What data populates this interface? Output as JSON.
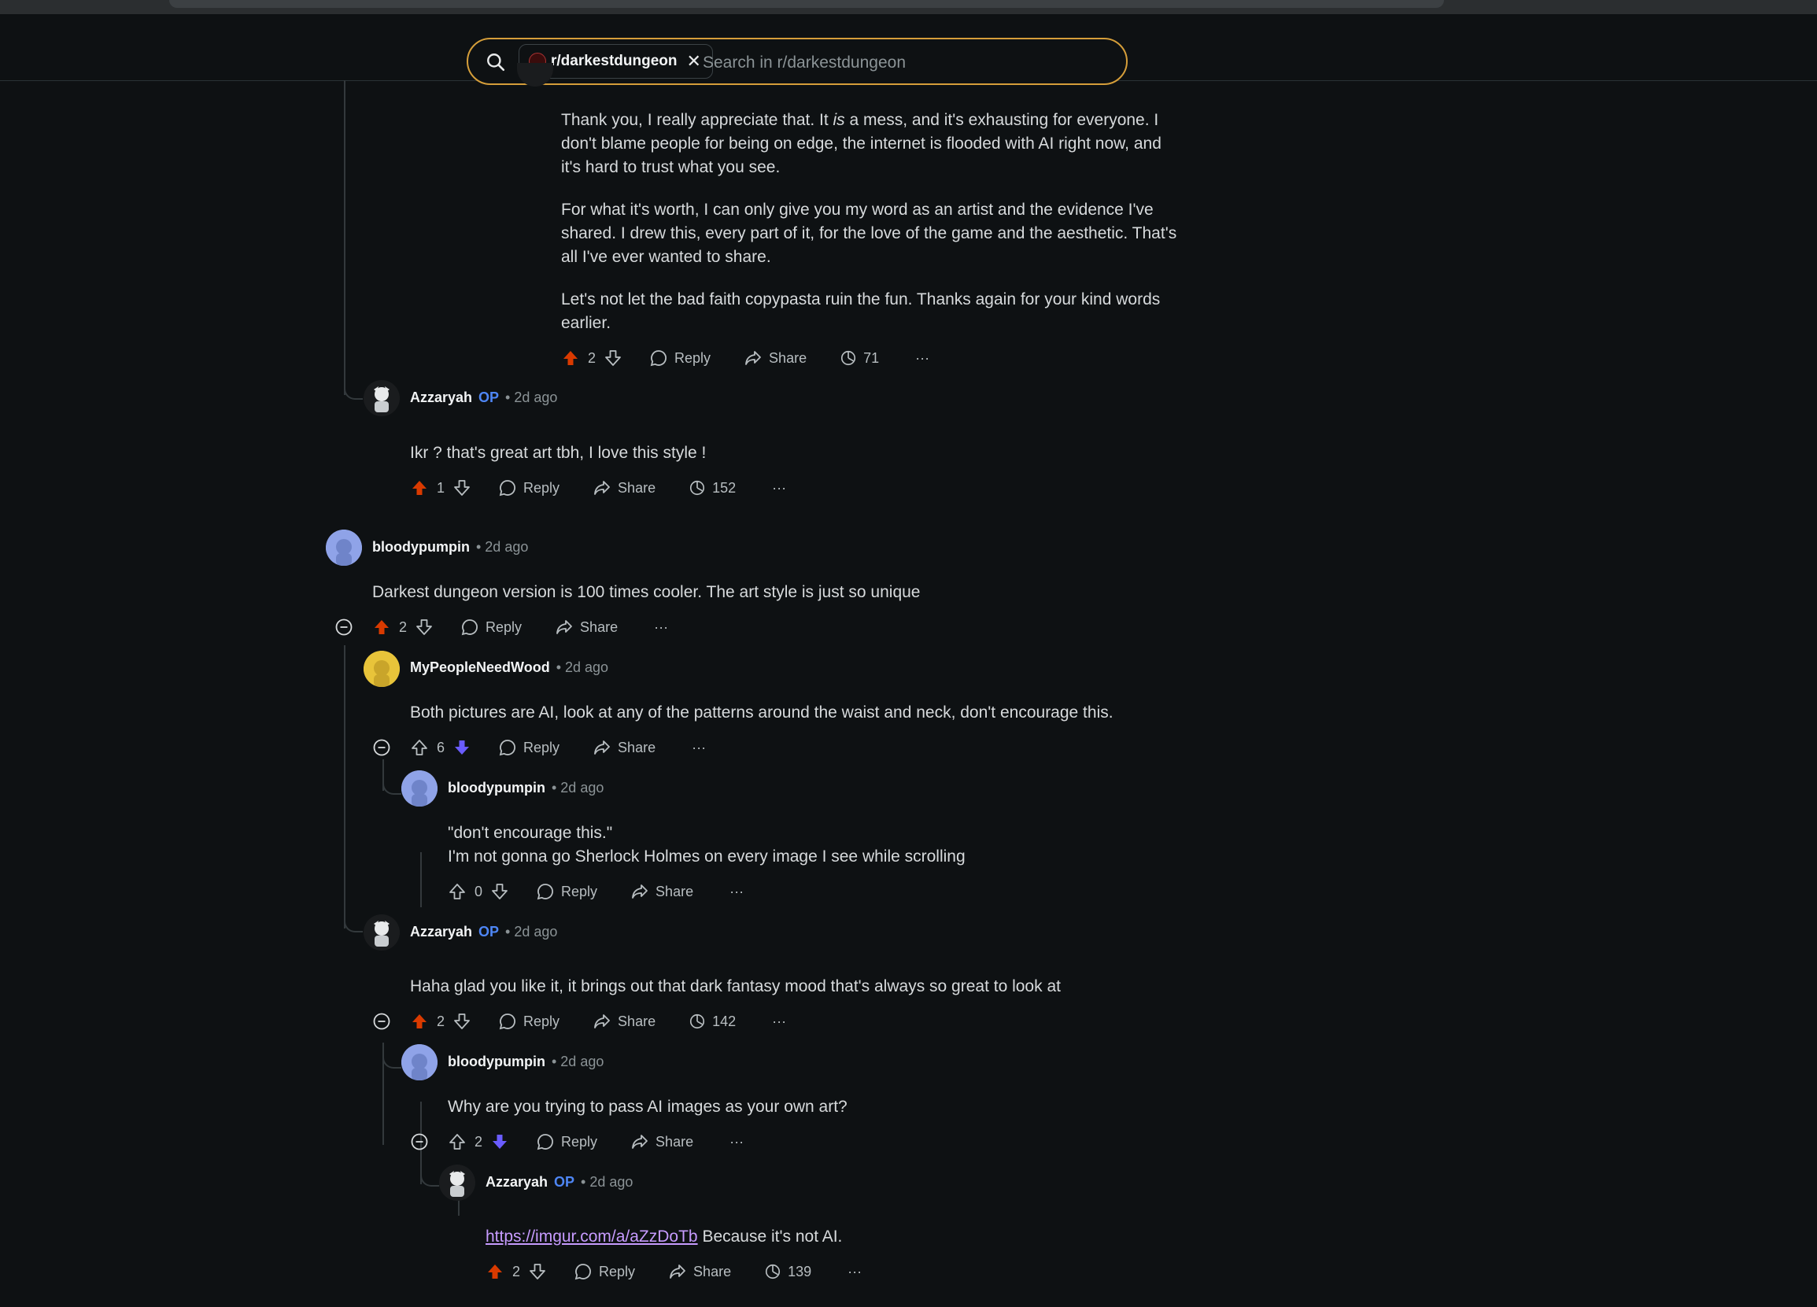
{
  "search": {
    "chip_label": "r/darkestdungeon",
    "placeholder": "Search in r/darkestdungeon"
  },
  "comments": [
    {
      "paragraphs": [
        "Thank you, I really appreciate that. It is a mess, and it's exhausting for everyone. I don't blame people for being on edge, the internet is flooded with AI right now, and it's hard to trust what you see.",
        "For what it's worth, I can only give you my word as an artist and the evidence I've shared. I drew this, every part of it, for the love of the game and the aesthetic. That's all I've ever wanted to share.",
        "Let's not let the bad faith copypasta ruin the fun. Thanks again for your kind words earlier."
      ],
      "p1_prefix": "Thank you, I really appreciate that. It ",
      "p1_emph": "is",
      "p1_suffix": " a mess, and it's exhausting for everyone. I don't blame people for being on edge, the internet is flooded with AI right now, and it's hard to trust what you see.",
      "votes": "2",
      "views": "71"
    },
    {
      "user": "Azzaryah",
      "op": "OP",
      "time": "2d ago",
      "body": "Ikr ? that's great art tbh, I love this style !",
      "votes": "1",
      "views": "152"
    },
    {
      "user": "bloodypumpin",
      "time": "2d ago",
      "body": "Darkest dungeon version is 100 times cooler. The art style is just so unique",
      "votes": "2"
    },
    {
      "user": "MyPeopleNeedWood",
      "time": "2d ago",
      "body": "Both pictures are AI, look at any of the patterns around the waist and neck, don't encourage this.",
      "votes": "6"
    },
    {
      "user": "bloodypumpin",
      "time": "2d ago",
      "line1": "\"don't encourage this.\"",
      "line2": "I'm not gonna go Sherlock Holmes on every image I see while scrolling",
      "votes": "0"
    },
    {
      "user": "Azzaryah",
      "op": "OP",
      "time": "2d ago",
      "body": "Haha glad you like it, it brings out that dark fantasy mood that's always so great to look at",
      "votes": "2",
      "views": "142"
    },
    {
      "user": "bloodypumpin",
      "time": "2d ago",
      "body": "Why are you trying to pass AI images as your own art?",
      "votes": "2"
    },
    {
      "user": "Azzaryah",
      "op": "OP",
      "time": "2d ago",
      "link": "https://imgur.com/a/aZzDoTb",
      "body_after": " Because it's not AI.",
      "votes": "2",
      "views": "139"
    }
  ],
  "labels": {
    "reply": "Reply",
    "share": "Share",
    "more": "···"
  },
  "colors": {
    "upvote_active": "#d93a00",
    "downvote_active": "#6a5cff",
    "accent_search": "#d59e3a",
    "op": "#4e86f5",
    "link": "#c79bff"
  }
}
